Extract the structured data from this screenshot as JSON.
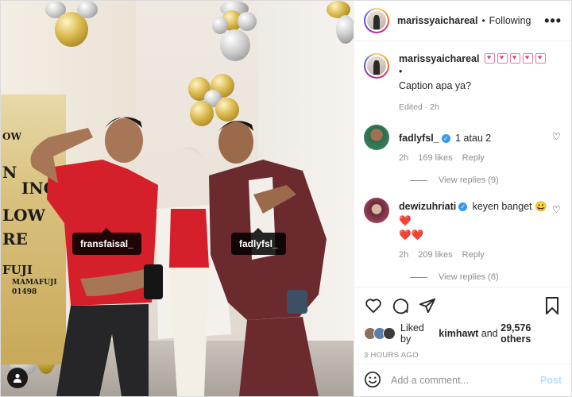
{
  "post": {
    "username": "marissyaichareal",
    "follow_state": "Following",
    "separator": "•",
    "more": "•••"
  },
  "photo": {
    "tags": [
      "fransfaisal_",
      "fadlyfsl_"
    ],
    "banner_lines": [
      "OW",
      "N",
      "ING",
      "LOW",
      "RE",
      "FUJI",
      "MAMAFUJI",
      "01498"
    ]
  },
  "caption": {
    "username": "marissyaichareal",
    "bullet": "•",
    "text": "Caption apa ya?",
    "meta": "Edited · 2h"
  },
  "comments": [
    {
      "username": "fadlyfsl_",
      "verified": true,
      "text": "1 atau 2",
      "time": "2h",
      "likes": "169 likes",
      "reply": "Reply",
      "view_replies": "View replies (9)"
    },
    {
      "username": "dewizuhriati",
      "verified": true,
      "text": "keyen banget 😀❤️",
      "text_line2": "❤️❤️",
      "time": "2h",
      "likes": "209 likes",
      "reply": "Reply",
      "view_replies": "View replies (8)"
    }
  ],
  "likes": {
    "prefix": "Liked by",
    "user": "kimhawt",
    "middle": "and",
    "count": "29,576 others"
  },
  "timestamp": "3 HOURS AGO",
  "composer": {
    "placeholder": "Add a comment...",
    "post_label": "Post"
  },
  "colors": {
    "verified": "#3897f0",
    "post_disabled": "#b2dffc",
    "heart": "#ed4956"
  }
}
